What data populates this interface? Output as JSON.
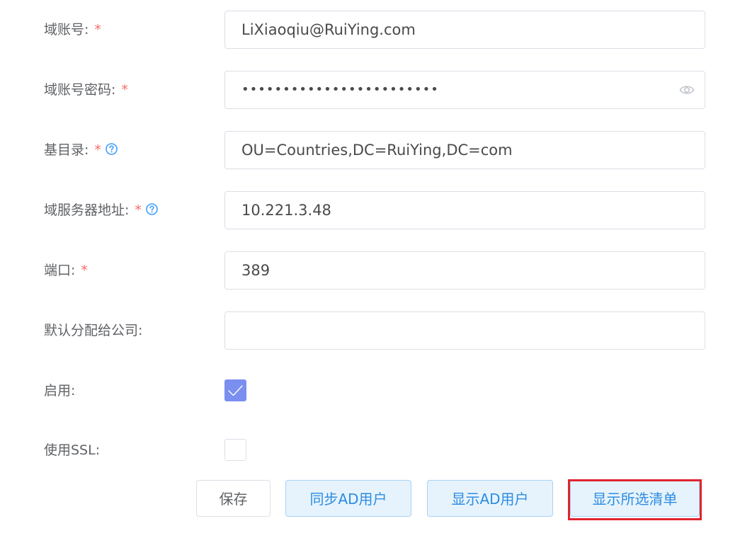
{
  "form": {
    "domain_account": {
      "label": "域账号:",
      "required_mark": "*",
      "value": "LiXiaoqiu@RuiYing.com"
    },
    "domain_password": {
      "label": "域账号密码:",
      "required_mark": "*",
      "value": "••••••••••••••••••••••••",
      "toggle_icon": "eye-icon"
    },
    "base_dn": {
      "label": "基目录:",
      "required_mark": "*",
      "help_icon": "question-circle-icon",
      "value": "OU=Countries,DC=RuiYing,DC=com"
    },
    "server_address": {
      "label": "域服务器地址:",
      "required_mark": "*",
      "help_icon": "question-circle-icon",
      "value": "10.221.3.48"
    },
    "port": {
      "label": "端口:",
      "required_mark": "*",
      "value": "389"
    },
    "default_company": {
      "label": "默认分配给公司:",
      "value": ""
    },
    "enabled": {
      "label": "启用:",
      "checked": true
    },
    "use_ssl": {
      "label": "使用SSL:",
      "checked": false
    }
  },
  "actions": {
    "save_label": "保存",
    "sync_ad_users_label": "同步AD用户",
    "show_ad_users_label": "显示AD用户",
    "show_selected_list_label": "显示所选清单"
  },
  "colors": {
    "required": "#f56c6c",
    "accent": "#409eff",
    "checkbox_checked": "#7b8ff0",
    "highlight_border": "#e0242f"
  }
}
